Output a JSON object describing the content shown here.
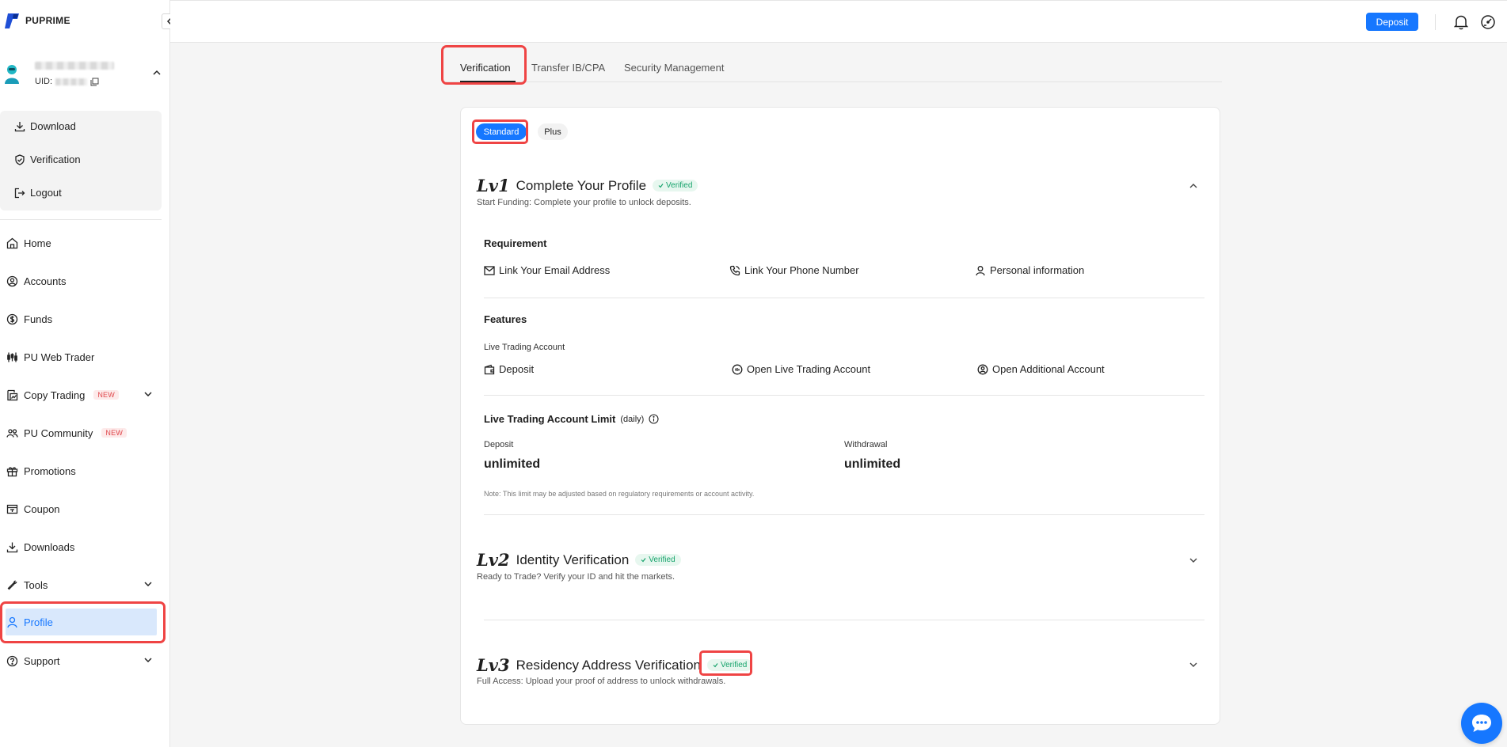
{
  "brand": {
    "name": "PUPRIME"
  },
  "user": {
    "uid_label": "UID:"
  },
  "user_menu": {
    "download": "Download",
    "verification": "Verification",
    "logout": "Logout"
  },
  "nav": {
    "home": "Home",
    "accounts": "Accounts",
    "funds": "Funds",
    "web_trader": "PU Web Trader",
    "copy_trading": "Copy Trading",
    "copy_trading_badge": "NEW",
    "community": "PU Community",
    "community_badge": "NEW",
    "promotions": "Promotions",
    "coupon": "Coupon",
    "downloads": "Downloads",
    "tools": "Tools",
    "profile": "Profile",
    "support": "Support"
  },
  "topbar": {
    "deposit_label": "Deposit"
  },
  "tabs": {
    "verification": "Verification",
    "transfer": "Transfer IB/CPA",
    "security": "Security Management"
  },
  "plan": {
    "standard": "Standard",
    "plus": "Plus"
  },
  "lv1": {
    "tag": "Lv1",
    "title": "Complete Your Profile",
    "status": "Verified",
    "subtitle": "Start Funding: Complete your profile to unlock deposits.",
    "requirement_title": "Requirement",
    "req_email": "Link Your Email Address",
    "req_phone": "Link Your Phone Number",
    "req_personal": "Personal information",
    "features_title": "Features",
    "features_group": "Live Trading Account",
    "feat_deposit": "Deposit",
    "feat_open_live": "Open Live Trading Account",
    "feat_open_additional": "Open Additional Account",
    "limit_title": "Live Trading Account Limit",
    "limit_period": "(daily)",
    "deposit_label": "Deposit",
    "deposit_value": "unlimited",
    "withdrawal_label": "Withdrawal",
    "withdrawal_value": "unlimited",
    "note": "Note: This limit may be adjusted based on regulatory requirements or account activity."
  },
  "lv2": {
    "tag": "Lv2",
    "title": "Identity Verification",
    "status": "Verified",
    "subtitle": "Ready to Trade? Verify your ID and hit the markets."
  },
  "lv3": {
    "tag": "Lv3",
    "title": "Residency Address Verification",
    "status": "Verified",
    "subtitle": "Full Access: Upload your proof of address to unlock withdrawals."
  },
  "colors": {
    "accent": "#1677ff",
    "highlight": "#ef4444",
    "verified_text": "#16a36b",
    "verified_bg": "#e7f7ef",
    "badge_new": "#e0484d"
  }
}
